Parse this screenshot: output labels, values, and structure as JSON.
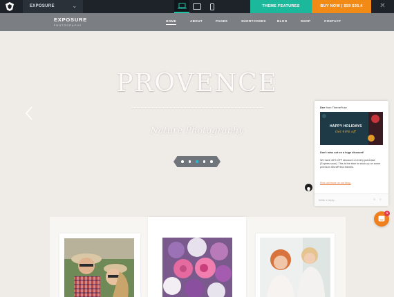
{
  "demobar": {
    "theme_select": "EXPOSURE",
    "devices": [
      "laptop-icon",
      "tablet-icon",
      "phone-icon"
    ],
    "features_label": "THEME FEATURES",
    "buy_label": "BUY NOW | $59 $35.4",
    "close_label": "✕",
    "colors": {
      "bar": "#1d2329",
      "features": "#1cb89b",
      "buy": "#f28a16"
    }
  },
  "header": {
    "brand_name": "EXPOSURE",
    "brand_sub": "PHOTOGRAPHY",
    "nav": [
      {
        "label": "HOME",
        "active": true
      },
      {
        "label": "ABOUT"
      },
      {
        "label": "PAGES"
      },
      {
        "label": "SHORTCODES"
      },
      {
        "label": "BLOG"
      },
      {
        "label": "SHOP"
      },
      {
        "label": "CONTACT"
      }
    ]
  },
  "hero": {
    "title": "PROVENCE",
    "subtitle": "Nature Photography",
    "slides_total": 5,
    "slide_active": 3
  },
  "chat": {
    "from_name": "Dee",
    "from_rest": " from ThemeFuse",
    "banner_title": "HAPPY HOLIDAYS",
    "banner_sub": "Get 40% off",
    "line1": "Don't miss out on a huge discount!",
    "line2": "We have 40% OFF discount on every purchase (Expires soon). This is the time to stock up on some premium WordPress themes.",
    "link": "Find out more on our blog.",
    "reply_placeholder": "Write a reply...",
    "unread_badge": "1"
  },
  "gallery": {
    "photos": [
      "couple-photo",
      "bouquet-photo",
      "bride-photo"
    ]
  }
}
